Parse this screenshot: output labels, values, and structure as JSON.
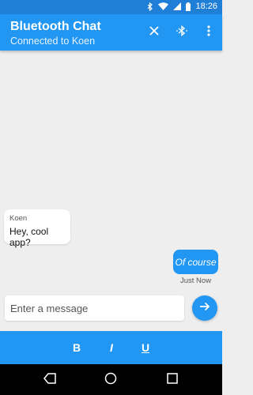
{
  "status_bar": {
    "time": "18:26",
    "icons": [
      "bluetooth-icon",
      "wifi-icon",
      "signal-icon",
      "battery-icon"
    ]
  },
  "app_bar": {
    "title": "Bluetooth Chat",
    "subtitle": "Connected to Koen",
    "actions": [
      "close-icon",
      "bluetooth-icon",
      "more-vertical-icon"
    ]
  },
  "messages": [
    {
      "direction": "incoming",
      "sender": "Koen",
      "text": "Hey, cool app?"
    },
    {
      "direction": "outgoing",
      "text": "Of course",
      "timestamp": "Just Now"
    }
  ],
  "composer": {
    "placeholder": "Enter a message",
    "value": "",
    "send_icon": "arrow-right-icon"
  },
  "format_bar": {
    "bold_label": "B",
    "italic_label": "I",
    "underline_label": "U"
  },
  "nav_bar": {
    "buttons": [
      "back-icon",
      "home-icon",
      "recents-icon"
    ]
  },
  "colors": {
    "status_bar": "#1f7fd6",
    "primary": "#2196f3",
    "background": "#eeeeee",
    "nav_bar": "#000000"
  }
}
